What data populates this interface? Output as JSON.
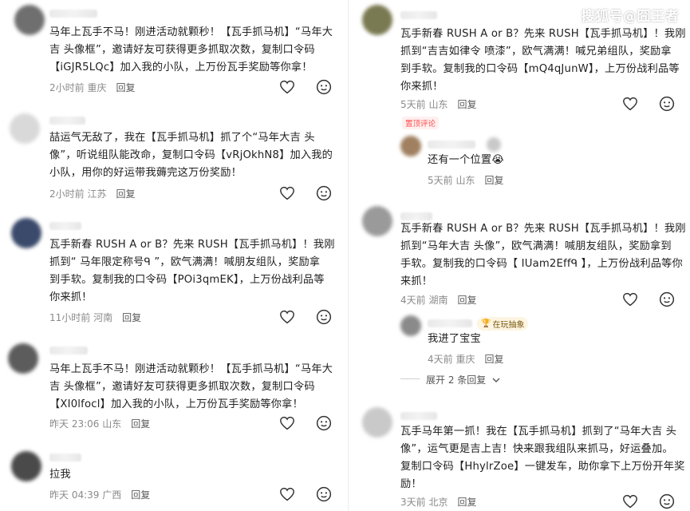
{
  "watermark": "搜狐号@囧王者",
  "left_comments": [
    {
      "lines": [
        "马年上瓦手不马！刚进活动就颗秒！【瓦手抓马机】“马年大",
        "吉 头像框”，邀请好友可获得更多抓取次数，复制口令码",
        "【iGJR5LQc】加入我的小队，上万份瓦手奖励等你拿！"
      ],
      "time": "2小时前 重庆",
      "reply": "回复"
    },
    {
      "lines": [
        "喆运气无敌了，我在【瓦手抓马机】抓了个“马年大吉 头",
        "像”，听说组队能改命，复制口令码【vRjOkhN8】加入我的",
        "小队，用你的好运带我薅完这万份奖励！"
      ],
      "time": "2小时前 江苏",
      "reply": "回复"
    },
    {
      "lines": [
        "瓦手新春 RUSH A or B？先来 RUSH【瓦手抓马机】！我刚",
        "抓到“ 马年限定称号ᑫ ”，欧气满满！喊朋友组队，奖励拿",
        "到手软。复制我的口令码【POi3qmEK】，上万份战利品等",
        "你来抓！"
      ],
      "time": "11小时前 河南",
      "reply": "回复"
    },
    {
      "lines": [
        "马年上瓦手不马！刚进活动就颗秒！【瓦手抓马机】“马年大",
        "吉 头像框”，邀请好友可获得更多抓取次数，复制口令码",
        "【XI0lfocl】加入我的小队，上万份瓦手奖励等你拿！"
      ],
      "time": "昨天 23:06 山东",
      "reply": "回复"
    },
    {
      "lines": [
        "拉我"
      ],
      "time": "昨天 04:39 广西",
      "reply": "回复"
    }
  ],
  "right_comments": [
    {
      "lines": [
        "瓦手新春 RUSH A or B？先来 RUSH【瓦手抓马机】！我刚",
        "抓到“吉吉如律令 喷漆”，欧气满满！喊兄弟组队，奖励拿",
        "到手软。复制我的口令码【mQ4qJunW】，上万份战利品等",
        "你来抓！"
      ],
      "time": "5天前 山东",
      "reply": "回复"
    },
    {
      "pinned": "置顶评论",
      "lines": [
        "还有一个位置😭"
      ],
      "time": "5天前 山东",
      "reply": "回复"
    },
    {
      "lines": [
        "瓦手新春 RUSH A or B？先来 RUSH【瓦手抓马机】！我刚",
        "抓到“马年大吉 头像”，欧气满满！喊朋友组队，奖励拿到",
        "手软。复制我的口令码【 IUam2Effᑫ 】，上万份战利品等你",
        "来抓！"
      ],
      "time": "4天前 湖南",
      "reply": "回复"
    },
    {
      "badge": "在玩抽象",
      "lines": [
        "我进了宝宝"
      ],
      "time": "4天前 重庆",
      "reply": "回复"
    },
    {
      "expand": "展开 2 条回复"
    },
    {
      "lines": [
        "瓦手马年第一抓！我在【瓦手抓马机】抓到了“马年大吉 头",
        "像”，运气更是吉上吉！快来跟我组队来抓马，好运叠加。",
        "复制口令码【HhylrZoe】一键发车，助你拿下上万份开年奖",
        "励！"
      ],
      "time": "3天前 北京",
      "reply": "回复"
    }
  ],
  "colors": {
    "avatar1": "#6f6f6f",
    "avatar2": "#d9d9d9",
    "avatar3": "#3b4a6b",
    "avatar4": "#5c5c5c",
    "avatar5": "#4a4a4a",
    "avatar6": "#7a7a52",
    "avatar7": "#a08060",
    "avatar8": "#9a9a9a",
    "avatar9": "#8a8a8a",
    "avatar10": "#c9c9c9"
  }
}
